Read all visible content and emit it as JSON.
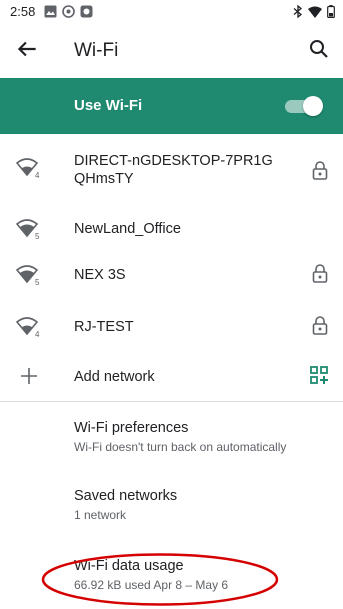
{
  "status_bar": {
    "time": "2:58"
  },
  "toolbar": {
    "title": "Wi-Fi"
  },
  "use_wifi": {
    "label": "Use Wi-Fi",
    "enabled": true,
    "accent": "#1f8a70"
  },
  "networks": [
    {
      "name_line1": "DIRECT-nGDESKTOP-7PR1G",
      "name_line2": "QHmsTY",
      "secured": true,
      "badge": "4",
      "icon": "wifi-signal-icon"
    },
    {
      "name": "NewLand_Office",
      "secured": false,
      "badge": "5",
      "icon": "wifi-signal-icon"
    },
    {
      "name": "NEX 3S",
      "secured": true,
      "badge": "5",
      "icon": "wifi-signal-icon"
    },
    {
      "name": "RJ-TEST",
      "secured": true,
      "badge": "4",
      "icon": "wifi-signal-icon"
    }
  ],
  "add_network": {
    "label": "Add network"
  },
  "preferences": {
    "title": "Wi-Fi preferences",
    "subtitle": "Wi-Fi doesn't turn back on automatically"
  },
  "saved_networks": {
    "title": "Saved networks",
    "subtitle": "1 network"
  },
  "data_usage": {
    "title": "Wi-Fi data usage",
    "subtitle": "66.92 kB used Apr 8 – May 6",
    "highlight_color": "#d50000"
  }
}
